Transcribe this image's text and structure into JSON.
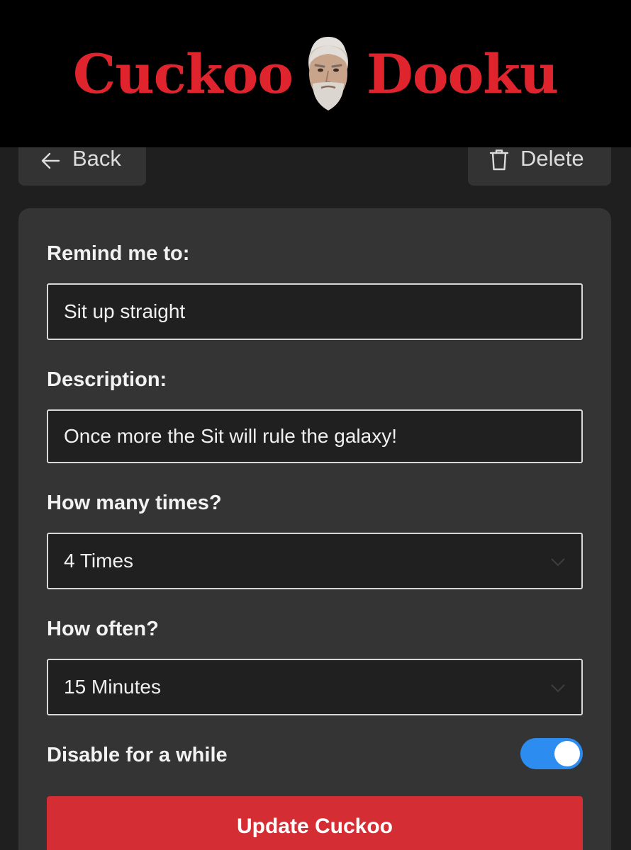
{
  "header": {
    "logo_left": "Cuckoo",
    "logo_right": "Dooku",
    "logo_color": "#e0242e"
  },
  "nav": {
    "back_label": "Back",
    "back_icon": "arrow-left-icon",
    "delete_label": "Delete",
    "delete_icon": "trash-icon"
  },
  "form": {
    "title_label": "Remind me to:",
    "title_value": "Sit up straight",
    "description_label": "Description:",
    "description_value": "Once more the Sit will rule the galaxy!",
    "times_label": "How many times?",
    "times_value": "4 Times",
    "often_label": "How often?",
    "often_value": "15 Minutes",
    "disable_label": "Disable for a while",
    "disable_on": true,
    "submit_label": "Update Cuckoo"
  },
  "colors": {
    "accent_red": "#d42e34",
    "toggle_blue": "#2d8cf0",
    "background": "#1f1f1f",
    "card": "#343434"
  }
}
